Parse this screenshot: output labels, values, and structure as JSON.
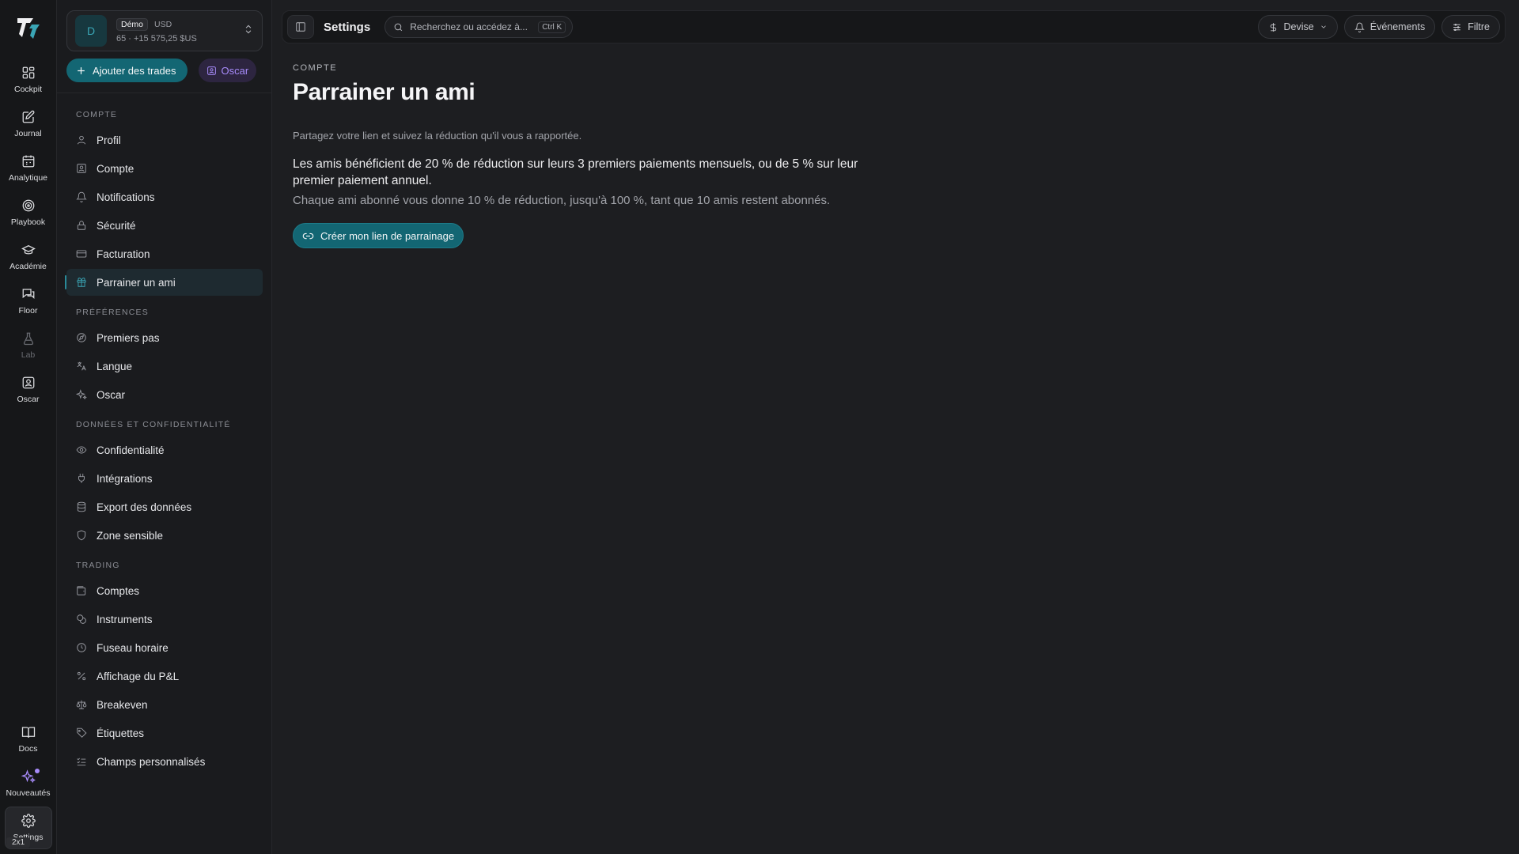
{
  "rail": {
    "items": [
      {
        "label": "Cockpit",
        "icon": "grid-icon"
      },
      {
        "label": "Journal",
        "icon": "edit-icon"
      },
      {
        "label": "Analytique",
        "icon": "calendar-chart-icon"
      },
      {
        "label": "Playbook",
        "icon": "target-icon"
      },
      {
        "label": "Académie",
        "icon": "graduation-cap-icon"
      },
      {
        "label": "Floor",
        "icon": "chat-bubbles-icon"
      },
      {
        "label": "Lab",
        "icon": "flask-icon"
      },
      {
        "label": "Oscar",
        "icon": "bot-icon"
      }
    ],
    "bottom": [
      {
        "label": "Docs",
        "icon": "book-icon"
      },
      {
        "label": "Nouveautés",
        "icon": "sparkles-icon"
      },
      {
        "label": "Settings",
        "icon": "gear-icon"
      }
    ],
    "zoom_badge": "2x1"
  },
  "account": {
    "avatar": "D",
    "badge": "Démo",
    "currency": "USD",
    "summary": "65 · +15 575,25 $US"
  },
  "actions": {
    "add_trades": "Ajouter des trades",
    "oscar": "Oscar"
  },
  "nav": {
    "sections": [
      {
        "title": "COMPTE",
        "items": [
          "Profil",
          "Compte",
          "Notifications",
          "Sécurité",
          "Facturation",
          "Parrainer un ami"
        ]
      },
      {
        "title": "PRÉFÉRENCES",
        "items": [
          "Premiers pas",
          "Langue",
          "Oscar"
        ]
      },
      {
        "title": "DONNÉES ET CONFIDENTIALITÉ",
        "items": [
          "Confidentialité",
          "Intégrations",
          "Export des données",
          "Zone sensible"
        ]
      },
      {
        "title": "TRADING",
        "items": [
          "Comptes",
          "Instruments",
          "Fuseau horaire",
          "Affichage du P&L",
          "Breakeven",
          "Étiquettes",
          "Champs personnalisés"
        ]
      }
    ],
    "active": "Parrainer un ami"
  },
  "topbar": {
    "title": "Settings",
    "search_placeholder": "Recherchez ou accédez à...",
    "search_shortcut": "Ctrl K",
    "currency": "Devise",
    "events": "Événements",
    "filter": "Filtre"
  },
  "content": {
    "eyebrow": "COMPTE",
    "title": "Parrainer un ami",
    "subtitle": "Partagez votre lien et suivez la réduction qu'il vous a rapportée.",
    "paragraph1": "Les amis bénéficient de 20 % de réduction sur leurs 3 premiers paiements mensuels, ou de 5 % sur leur premier paiement annuel.",
    "paragraph2": "Chaque ami abonné vous donne 10 % de réduction, jusqu'à 100 %, tant que 10 amis restent abonnés.",
    "cta": "Créer mon lien de parrainage"
  }
}
